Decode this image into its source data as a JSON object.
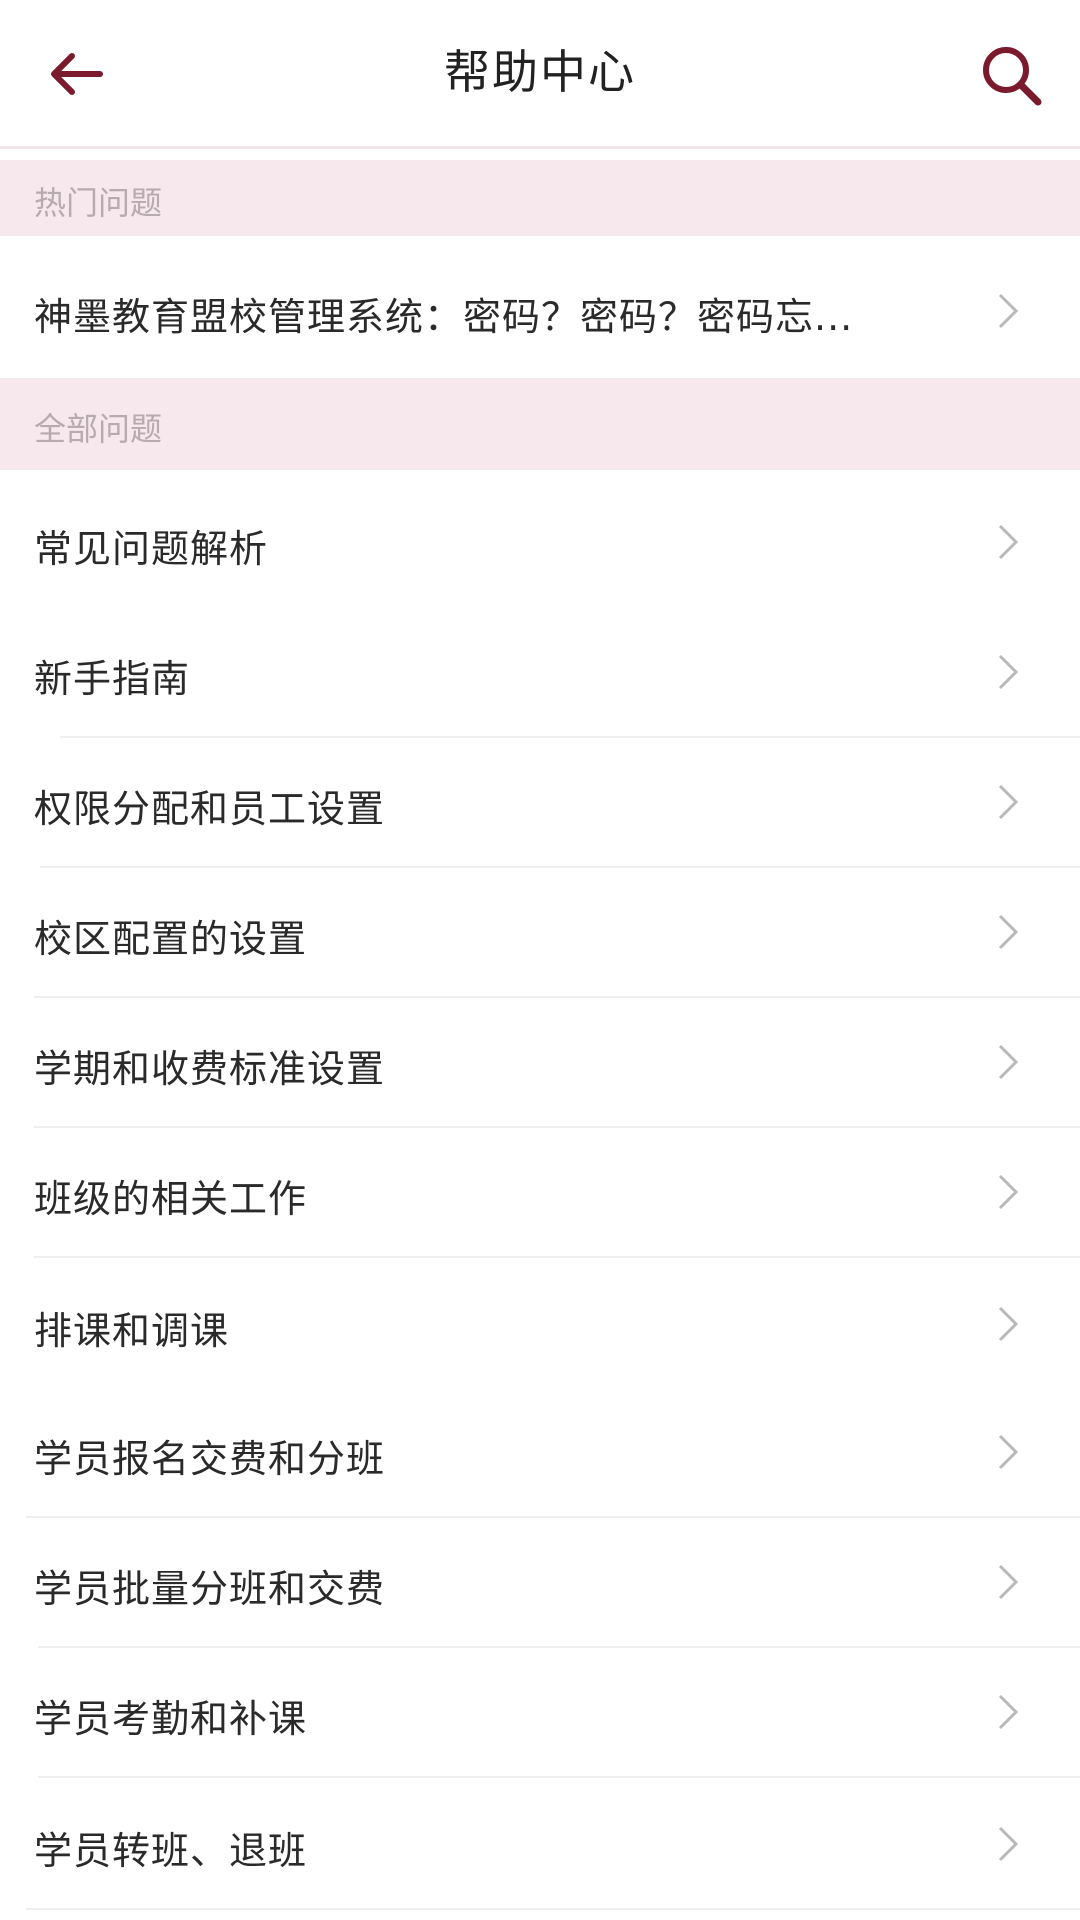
{
  "header": {
    "title": "帮助中心",
    "back_icon": "arrow-left-icon",
    "search_icon": "search-icon",
    "accent_color": "#7a1a2c"
  },
  "hot_section": {
    "title": "热门问题",
    "items": [
      {
        "label": "神墨教育盟校管理系统：密码？密码？密码忘..."
      }
    ]
  },
  "all_section": {
    "title": "全部问题",
    "items": [
      {
        "label": "常见问题解析"
      },
      {
        "label": "新手指南"
      },
      {
        "label": "权限分配和员工设置"
      },
      {
        "label": "校区配置的设置"
      },
      {
        "label": "学期和收费标准设置"
      },
      {
        "label": "班级的相关工作"
      },
      {
        "label": "排课和调课"
      },
      {
        "label": "学员报名交费和分班"
      },
      {
        "label": "学员批量分班和交费"
      },
      {
        "label": "学员考勤和补课"
      },
      {
        "label": "学员转班、退班"
      }
    ]
  },
  "colors": {
    "section_bg": "#f6e8ec",
    "section_text": "#b7aab0",
    "chevron": "#b9b9b9",
    "divider": "#efefef"
  }
}
